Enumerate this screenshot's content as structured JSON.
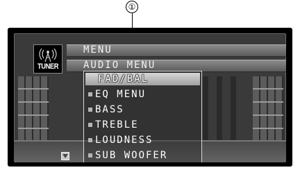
{
  "callout": {
    "number": "①"
  },
  "source_badge": {
    "label": "TUNER",
    "icon": "antenna-icon"
  },
  "header": {
    "rows": [
      {
        "label": "MENU"
      },
      {
        "label": "AUDIO MENU"
      }
    ]
  },
  "menu": {
    "selected_index": 0,
    "items": [
      {
        "label": "FAD/BAL"
      },
      {
        "label": "EQ MENU"
      },
      {
        "label": "BASS"
      },
      {
        "label": "TREBLE"
      },
      {
        "label": "LOUDNESS"
      },
      {
        "label": "SUB WOOFER"
      }
    ]
  },
  "scroll": {
    "icon": "scroll-down-arrow-icon"
  }
}
